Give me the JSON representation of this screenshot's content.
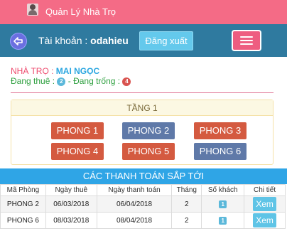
{
  "app": {
    "title": "Quản Lý Nhà Trọ"
  },
  "user": {
    "account_label": "Tài khoản :",
    "username": "odahieu",
    "logout_label": "Đăng xuất"
  },
  "house": {
    "label": "NHÀ TRỌ :",
    "name": "MAI NGỌC",
    "rented_label": "Đang thuê :",
    "rented_count": "2",
    "separator": "-",
    "vacant_label": "Đang trống :",
    "vacant_count": "4"
  },
  "floor": {
    "title": "TẦNG 1",
    "rooms": [
      "PHONG 1",
      "PHONG 2",
      "PHONG 3",
      "PHONG 4",
      "PHONG 5",
      "PHONG 6"
    ],
    "colors": {
      "occupied": "#d45a40",
      "vacant": "#5f79a8"
    }
  },
  "payments": {
    "title": "CÁC THANH TOÁN SẮP TỚI",
    "headers": [
      "Mã Phòng",
      "Ngày thuê",
      "Ngày thanh toán",
      "Tháng",
      "Số khách",
      "Chi tiết"
    ],
    "rows": [
      {
        "room": "PHONG 2",
        "rent_date": "06/03/2018",
        "pay_date": "06/04/2018",
        "month": "2",
        "guests": "1",
        "action": "Xem"
      },
      {
        "room": "PHONG 6",
        "rent_date": "08/03/2018",
        "pay_date": "08/04/2018",
        "month": "2",
        "guests": "1",
        "action": "Xem"
      }
    ]
  }
}
